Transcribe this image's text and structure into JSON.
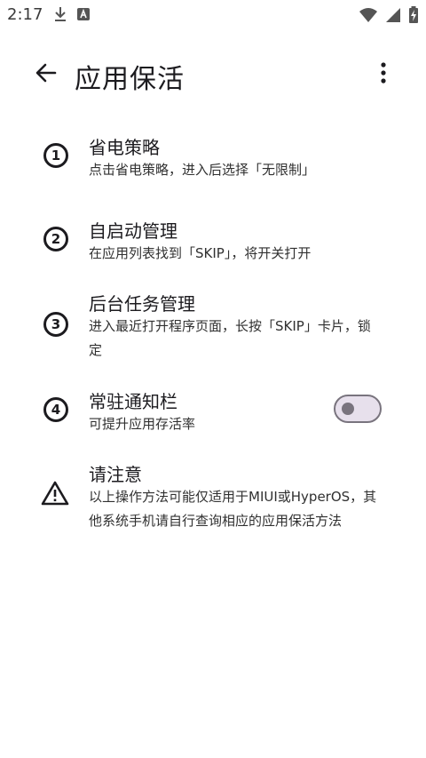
{
  "status_bar": {
    "time": "2:17",
    "icons_left": [
      "download-icon",
      "app-a-icon"
    ],
    "icons_right": [
      "wifi-icon",
      "signal-icon",
      "battery-charging-icon"
    ]
  },
  "app_bar": {
    "title": "应用保活",
    "back_icon": "arrow-back-icon",
    "more_icon": "more-vert-icon"
  },
  "items": [
    {
      "number": "1",
      "title": "省电策略",
      "description": "点击省电策略，进入后选择「无限制」"
    },
    {
      "number": "2",
      "title": "自启动管理",
      "description": "在应用列表找到「SKIP」，将开关打开"
    },
    {
      "number": "3",
      "title": "后台任务管理",
      "description": "进入最近打开程序页面，长按「SKIP」卡片，锁定"
    },
    {
      "number": "4",
      "title": "常驻通知栏",
      "description": "可提升应用存活率",
      "toggle_on": false
    },
    {
      "title": "请注意",
      "description": "以上操作方法可能仅适用于MIUI或HyperOS，其他系统手机请自行查询相应的应用保活方法",
      "icon": "warning-icon"
    }
  ],
  "colors": {
    "text_primary": "#1c1b1f",
    "toggle_track": "#e7e0ec",
    "toggle_outline": "#79747e"
  }
}
